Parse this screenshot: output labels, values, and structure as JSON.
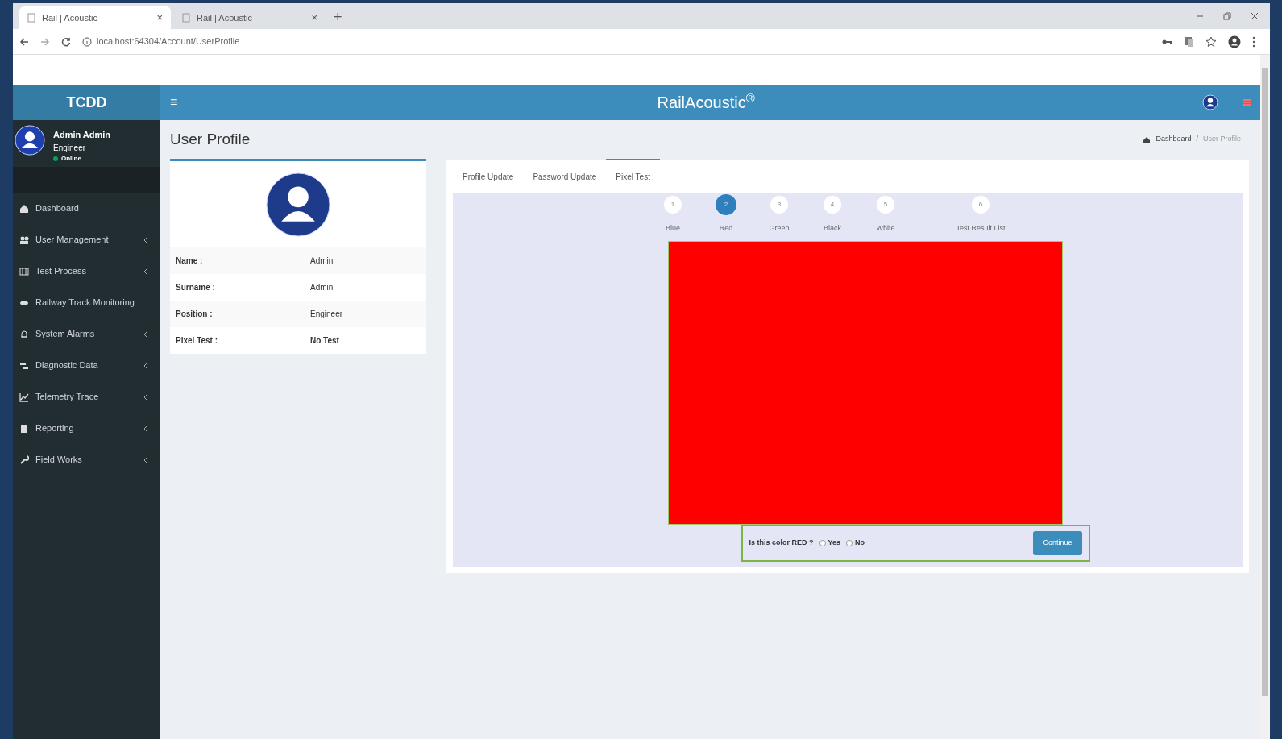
{
  "browser": {
    "tabs": [
      {
        "title": "Rail | Acoustic",
        "selected": true,
        "close": "×"
      },
      {
        "title": "Rail | Acoustic",
        "selected": false,
        "close": "×"
      }
    ],
    "new_tab": "+",
    "address": "localhost:64304/Account/UserProfile"
  },
  "header": {
    "brand": "TCDD",
    "menu_glyph": "≡",
    "title": "RailAcoustic",
    "title_mark": "®"
  },
  "sidebar": {
    "user": {
      "name": "Admin Admin",
      "role": "Engineer",
      "status": "Online"
    },
    "items": [
      {
        "label": "Dashboard",
        "has_children": false
      },
      {
        "label": "User Management",
        "has_children": true
      },
      {
        "label": "Test Process",
        "has_children": true
      },
      {
        "label": "Railway Track Monitoring",
        "has_children": false
      },
      {
        "label": "System Alarms",
        "has_children": true
      },
      {
        "label": "Diagnostic Data",
        "has_children": true
      },
      {
        "label": "Telemetry Trace",
        "has_children": true
      },
      {
        "label": "Reporting",
        "has_children": true
      },
      {
        "label": "Field Works",
        "has_children": true
      }
    ]
  },
  "page": {
    "title": "User Profile",
    "breadcrumb": [
      "Dashboard",
      "User Profile"
    ],
    "breadcrumb_separator": "/"
  },
  "profile": {
    "fields": [
      {
        "label": "Name :",
        "value": "Admin",
        "bold": false
      },
      {
        "label": "Surname :",
        "value": "Admin",
        "bold": false
      },
      {
        "label": "Position :",
        "value": "Engineer",
        "bold": false
      },
      {
        "label": "Pixel Test :",
        "value": "No Test",
        "bold": true
      }
    ]
  },
  "tabs": [
    {
      "label": "Profile Update",
      "selected": false
    },
    {
      "label": "Password Update",
      "selected": false
    },
    {
      "label": "Pixel Test",
      "selected": true
    }
  ],
  "steps": [
    {
      "number": "1",
      "label": "Blue",
      "selected": false
    },
    {
      "number": "2",
      "label": "Red",
      "selected": true
    },
    {
      "number": "3",
      "label": "Green",
      "selected": false
    },
    {
      "number": "4",
      "label": "Black",
      "selected": false
    },
    {
      "number": "5",
      "label": "White",
      "selected": false
    },
    {
      "number": "6",
      "label": "Test Result List",
      "selected": false
    }
  ],
  "test": {
    "color": "#ff0000",
    "question": "Is this color RED ?",
    "options": [
      {
        "label": "Yes",
        "checked": false
      },
      {
        "label": "No",
        "checked": false
      }
    ],
    "button": "Continue"
  }
}
